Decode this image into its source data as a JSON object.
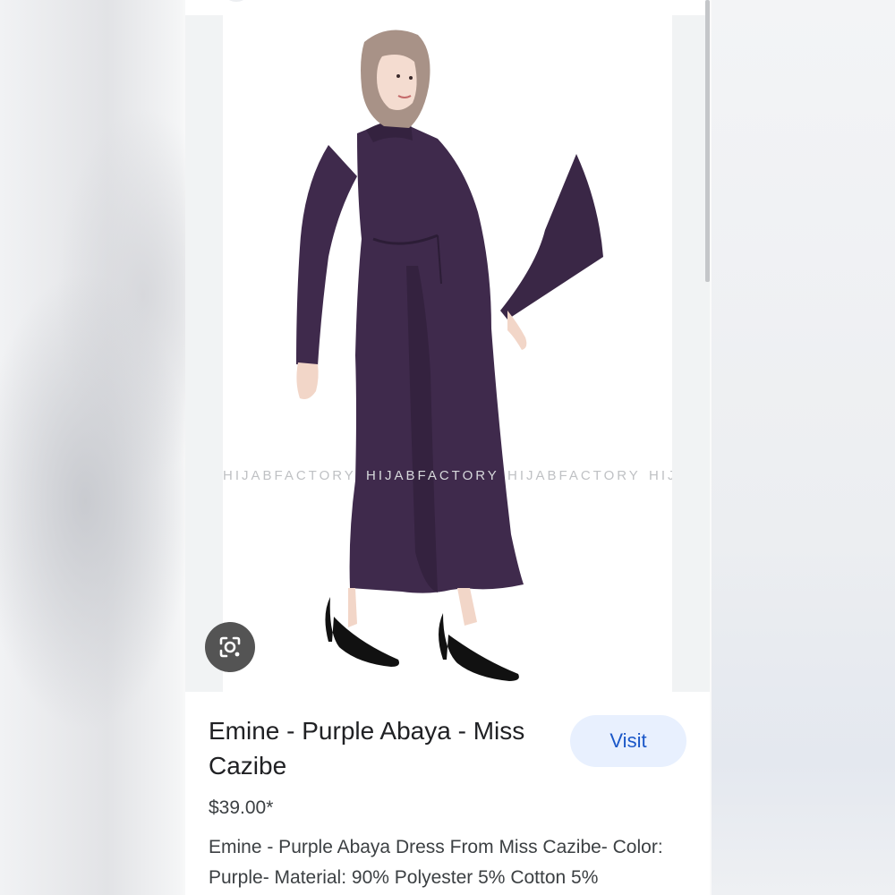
{
  "product": {
    "title": "Emine - Purple Abaya - Miss Cazibe",
    "visit_label": "Visit",
    "price": "$39.00*",
    "description": "Emine - Purple Abaya Dress From Miss Cazibe- Color: Purple- Material: 90% Polyester 5% Cotton 5%",
    "watermark_1": "HIJABFACTORY",
    "watermark_2": "HIJABFACTORY",
    "watermark_3": "HIJABFACTORY",
    "watermark_4": "HIJ"
  },
  "icons": {
    "lens": "lens-camera-icon"
  },
  "colors": {
    "dress": "#3f2a4c",
    "hijab": "#a89287",
    "visit_bg": "#e8f0fe",
    "visit_text": "#1a57c8"
  }
}
